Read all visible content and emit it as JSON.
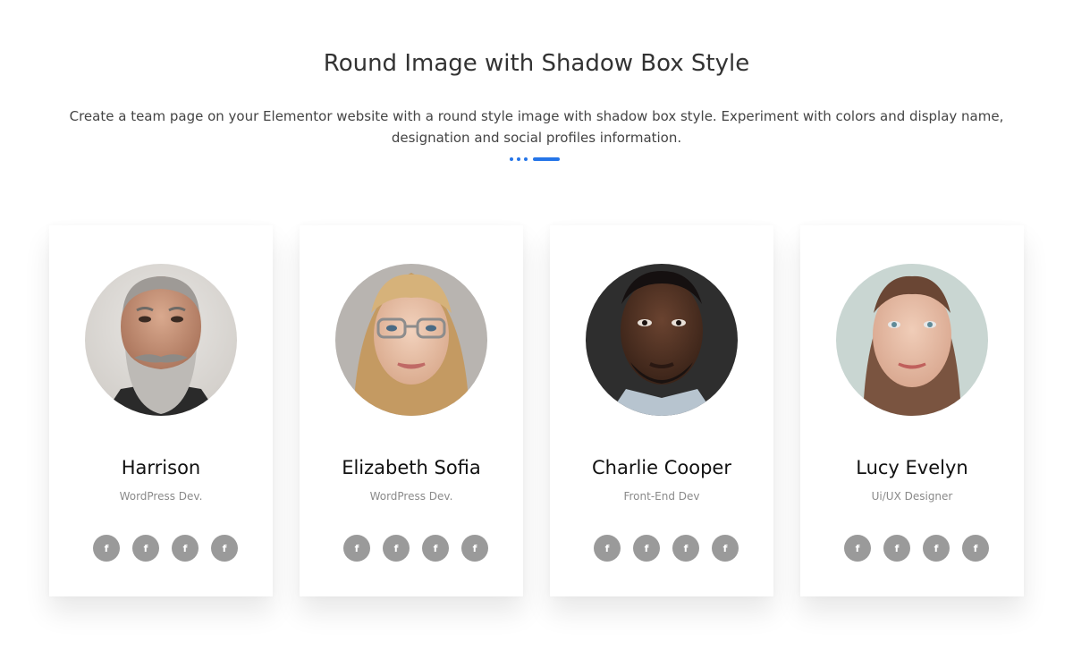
{
  "header": {
    "title": "Round Image with Shadow Box Style",
    "description": "Create a team page on your Elementor website with a round style image with shadow box style. Experiment with colors and display name, designation and social profiles information."
  },
  "colors": {
    "accent": "#2575e8",
    "social_bg": "#9a9a9a",
    "card_bg": "#ffffff"
  },
  "team": [
    {
      "name": "Harrison",
      "role": "WordPress Dev.",
      "social_icons": [
        "facebook-icon",
        "facebook-icon",
        "facebook-icon",
        "facebook-icon"
      ],
      "social_glyph": "f"
    },
    {
      "name": "Elizabeth Sofia",
      "role": "WordPress Dev.",
      "social_icons": [
        "facebook-icon",
        "facebook-icon",
        "facebook-icon",
        "facebook-icon"
      ],
      "social_glyph": "f"
    },
    {
      "name": "Charlie Cooper",
      "role": "Front-End Dev",
      "social_icons": [
        "facebook-icon",
        "facebook-icon",
        "facebook-icon",
        "facebook-icon"
      ],
      "social_glyph": "f"
    },
    {
      "name": "Lucy Evelyn",
      "role": "Ui/UX Designer",
      "social_icons": [
        "facebook-icon",
        "facebook-icon",
        "facebook-icon",
        "facebook-icon"
      ],
      "social_glyph": "f"
    }
  ]
}
